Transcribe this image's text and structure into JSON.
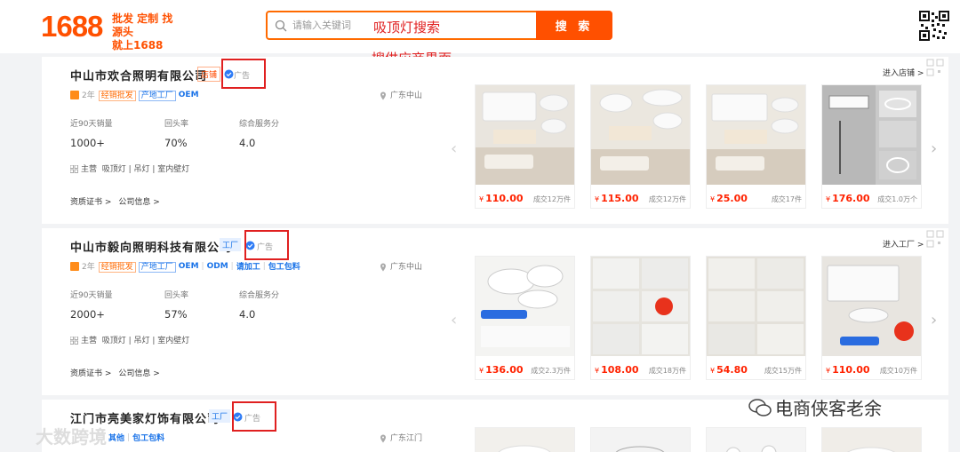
{
  "header": {
    "logo_number": "1688",
    "logo_slogan_1": "批发 定制 找源头",
    "logo_slogan_2": "就上1688",
    "search_placeholder": "请输入关键词",
    "search_button": "搜 索"
  },
  "annotations": {
    "search_note": "吸顶灯搜索",
    "page_note": "搜供应商界面"
  },
  "labels": {
    "ad": "广告",
    "sales_90": "近90天销量",
    "repeat_rate": "回头率",
    "service_score": "综合服务分",
    "main_prefix": "主营",
    "certs": "资质证书 >",
    "company_info": "公司信息 >"
  },
  "suppliers": [
    {
      "name": "中山市欢合照明有限公司",
      "type_tag": "店铺",
      "years": "2年",
      "badges": [
        "经销批发",
        "产地工厂",
        "OEM"
      ],
      "location": "广东中山",
      "sales": "1000+",
      "repeat": "70%",
      "score": "4.0",
      "main": "吸顶灯 | 吊灯 | 室内壁灯",
      "enter": "进入店铺 >",
      "products": [
        {
          "price": "110.00",
          "sold": "成交12万件"
        },
        {
          "price": "115.00",
          "sold": "成交12万件"
        },
        {
          "price": "25.00",
          "sold": "成交17件"
        },
        {
          "price": "176.00",
          "sold": "成交1.0万个"
        }
      ]
    },
    {
      "name": "中山市毅向照明科技有限公司",
      "type_tag": "工厂",
      "years": "2年",
      "badges": [
        "经销批发",
        "产地工厂",
        "OEM",
        "ODM",
        "请加工",
        "包工包料"
      ],
      "location": "广东中山",
      "sales": "2000+",
      "repeat": "57%",
      "score": "4.0",
      "main": "吸顶灯 | 吊灯 | 室内壁灯",
      "enter": "进入工厂 >",
      "products": [
        {
          "price": "136.00",
          "sold": "成交2.3万件"
        },
        {
          "price": "108.00",
          "sold": "成交18万件"
        },
        {
          "price": "54.80",
          "sold": "成交15万件"
        },
        {
          "price": "110.00",
          "sold": "成交10万件"
        }
      ]
    },
    {
      "name": "江门市亮美家灯饰有限公司",
      "type_tag": "工厂",
      "years": "",
      "badges": [
        "其他",
        "包工包料"
      ],
      "location": "广东江门"
    }
  ],
  "watermarks": {
    "wechat": "电商侠客老余",
    "corner": "大数跨境"
  },
  "colors": {
    "brand": "#ff5000",
    "price": "#ff2200",
    "link": "#1a73e8",
    "annotation": "#e02020"
  }
}
